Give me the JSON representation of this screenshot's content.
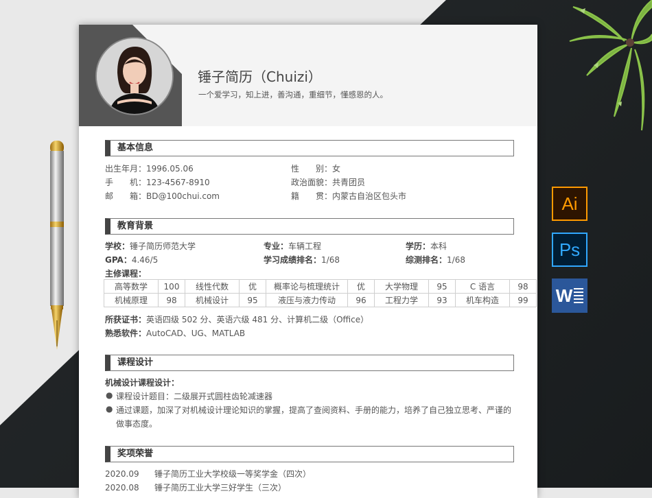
{
  "resume": {
    "name": "锤子简历（Chuizi）",
    "motto": "一个爱学习，知上进，善沟通，重细节，懂感恩的人。",
    "sections": {
      "basic": "基本信息",
      "education": "教育背景",
      "course_design": "课程设计",
      "awards": "奖项荣誉"
    },
    "basic": {
      "birth_label": "出生年月：",
      "birth": "1996.05.06",
      "gender_label": "性　　别：",
      "gender": "女",
      "phone_label": "手　　机：",
      "phone": "123-4567-8910",
      "politics_label": "政治面貌：",
      "politics": "共青团员",
      "email_label": "邮　　箱：",
      "email": "BD@100chui.com",
      "hometown_label": "籍　　贯：",
      "hometown": "内蒙古自治区包头市"
    },
    "education": {
      "school_label": "学校：",
      "school": "锤子简历师范大学",
      "major_label": "专业：",
      "major": "车辆工程",
      "degree_label": "学历：",
      "degree": "本科",
      "gpa_label": "GPA：",
      "gpa": "4.46/5",
      "rank_label": "学习成绩排名：",
      "rank": "1/68",
      "overall_rank_label": "综测排名：",
      "overall_rank": "1/68",
      "courses_label": "主修课程：",
      "courses": [
        [
          "高等数学",
          "100",
          "线性代数",
          "优",
          "概率论与梳理统计",
          "优",
          "大学物理",
          "95",
          "C 语言",
          "98"
        ],
        [
          "机械原理",
          "98",
          "机械设计",
          "95",
          "液压与液力传动",
          "96",
          "工程力学",
          "93",
          "机车构造",
          "99"
        ]
      ],
      "cert_label": "所获证书：",
      "certs": "英语四级 502 分、英语六级 481 分、计算机二级（Office）",
      "software_label": "熟悉软件：",
      "software": "AutoCAD、UG、MATLAB"
    },
    "course_design": {
      "subtitle": "机械设计课程设计：",
      "bullets": [
        "课程设计题目：二级展开式圆柱齿轮减速器",
        "通过课题，加深了对机械设计理论知识的掌握，提高了查阅资料、手册的能力，培养了自己独立思考、严谨的",
        "做事态度。"
      ]
    },
    "awards": [
      {
        "date": "2020.09",
        "text": "锤子简历工业大学校级一等奖学金（四次）"
      },
      {
        "date": "2020.08",
        "text": "锤子简历工业大学三好学生（三次）"
      }
    ]
  },
  "apps": {
    "ai": "Ai",
    "ps": "Ps",
    "word": "W"
  },
  "colors": {
    "dark_bg": "#1d2123",
    "section_bar": "#444444"
  }
}
